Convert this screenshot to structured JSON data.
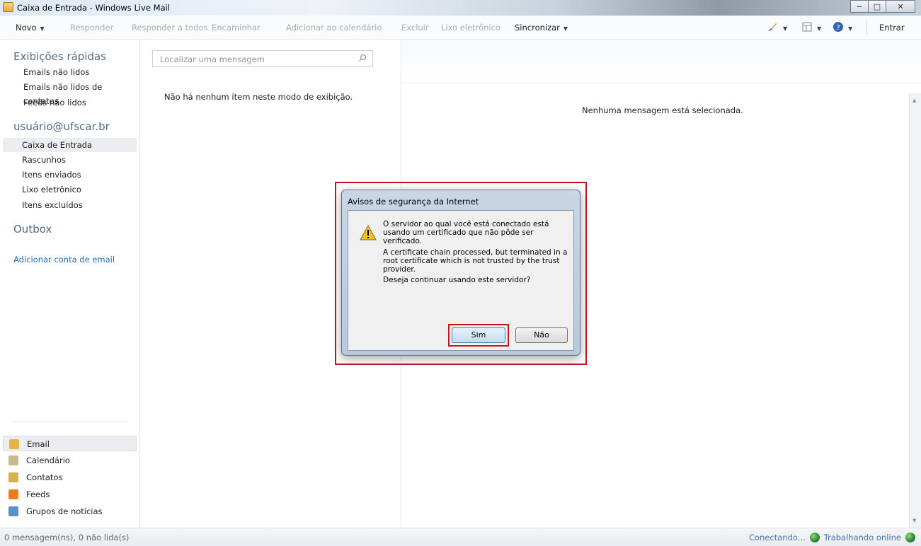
{
  "window": {
    "title": "Caixa de Entrada - Windows Live Mail",
    "controls": {
      "minimize": "−",
      "maximize": "□",
      "close": "✕"
    }
  },
  "toolbar": {
    "novo": "Novo",
    "responder": "Responder",
    "responder_todos": "Responder a todos",
    "encaminhar": "Encaminhar",
    "adicionar_calendario": "Adicionar ao calendário",
    "excluir": "Excluir",
    "lixo": "Lixo eletrônico",
    "sincronizar": "Sincronizar",
    "entrar": "Entrar",
    "icons": [
      "paintbrush-icon",
      "layout-icon",
      "help-icon"
    ]
  },
  "sidebar": {
    "quick_views_heading": "Exibições rápidas",
    "quick_views": [
      "Emails não lidos",
      "Emails não lidos de contatos",
      "Feeds não lidos"
    ],
    "account_heading": "usuário@ufscar.br",
    "folders": [
      "Caixa de Entrada",
      "Rascunhos",
      "Itens enviados",
      "Lixo eletrônico",
      "Itens excluídos"
    ],
    "selected_folder": "Caixa de Entrada",
    "outbox_heading": "Outbox",
    "add_account": "Adicionar conta de email",
    "modules": [
      {
        "label": "Email",
        "icon": "email-icon",
        "color": "#e8b24a"
      },
      {
        "label": "Calendário",
        "icon": "calendar-icon",
        "color": "#c7b98a"
      },
      {
        "label": "Contatos",
        "icon": "contacts-icon",
        "color": "#d9b14c"
      },
      {
        "label": "Feeds",
        "icon": "feeds-icon",
        "color": "#f07b1a"
      },
      {
        "label": "Grupos de notícias",
        "icon": "newsgroups-icon",
        "color": "#5a8fd0"
      }
    ]
  },
  "message_list": {
    "search_placeholder": "Localizar uma mensagem",
    "empty_text": "Não há nenhum item neste modo de exibição."
  },
  "reading_pane": {
    "empty_text": "Nenhuma mensagem está selecionada."
  },
  "status_bar": {
    "left": "0 mensagem(ns), 0 não lida(s)",
    "connecting": "Conectando...",
    "online": "Trabalhando online"
  },
  "dialog": {
    "title": "Avisos de segurança da Internet",
    "icon": "warning-icon",
    "text1": "O servidor ao qual você está conectado está usando um certificado que não pôde ser verificado.",
    "text2": "A certificate chain processed, but terminated in a root certificate which is not trusted by the trust provider.",
    "text3": "Deseja continuar usando este servidor?",
    "yes_label": "Sim",
    "no_label": "Não",
    "highlight_color": "#c4161c"
  }
}
